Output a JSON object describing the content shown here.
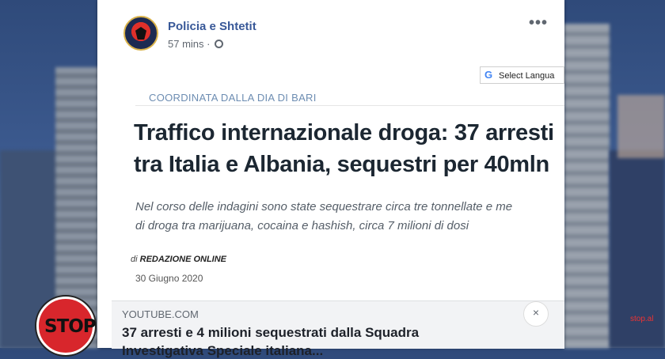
{
  "post": {
    "page_name": "Policia e Shtetit",
    "time": "57 mins",
    "separator": "·",
    "more_icon": "more-horizontal-icon",
    "globe_icon": "globe-icon"
  },
  "article": {
    "translate_label": "Select Langua",
    "kicker": "COORDINATA DALLA DIA DI BARI",
    "headline_1": "Traffico internazionale droga: 37 arresti",
    "headline_2": "tra Italia e Albania, sequestri per 40mln",
    "summary_1": "Nel corso delle indagini sono state sequestrare circa tre tonnellate e me",
    "summary_2": "di droga tra marijuana, cocaina e hashish, circa 7 milioni di dosi",
    "author_prefix": "di",
    "author": "REDAZIONE ONLINE",
    "date": "30 Giugno 2020"
  },
  "link_preview": {
    "domain": "YOUTUBE.COM",
    "title": "37 arresti e 4 milioni sequestrati dalla Squadra",
    "title_2": "Investigativa Speciale italiana...",
    "close_label": "×"
  },
  "overlay": {
    "stop_logo": "STOP",
    "channel_tag": "stop.al"
  },
  "colors": {
    "page_name": "#385898",
    "kicker": "#6d8db2",
    "stop_red": "#d8262c"
  }
}
